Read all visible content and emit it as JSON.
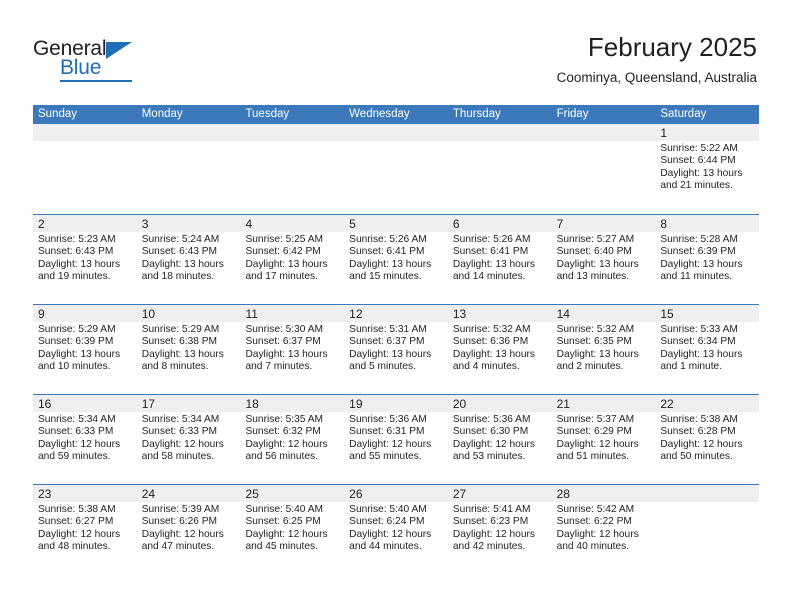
{
  "brand": {
    "name_part1": "General",
    "name_part2": "Blue",
    "accent_color": "#1f6fb5"
  },
  "header": {
    "month_title": "February 2025",
    "location": "Coominya, Queensland, Australia"
  },
  "calendar": {
    "header_bg": "#3b79ba",
    "daynum_band_bg": "#efefef",
    "day_headers": [
      "Sunday",
      "Monday",
      "Tuesday",
      "Wednesday",
      "Thursday",
      "Friday",
      "Saturday"
    ],
    "weeks": [
      [
        {
          "day": "",
          "empty": true
        },
        {
          "day": "",
          "empty": true
        },
        {
          "day": "",
          "empty": true
        },
        {
          "day": "",
          "empty": true
        },
        {
          "day": "",
          "empty": true
        },
        {
          "day": "",
          "empty": true
        },
        {
          "day": "1",
          "sunrise": "Sunrise: 5:22 AM",
          "sunset": "Sunset: 6:44 PM",
          "daylight": "Daylight: 13 hours and 21 minutes."
        }
      ],
      [
        {
          "day": "2",
          "sunrise": "Sunrise: 5:23 AM",
          "sunset": "Sunset: 6:43 PM",
          "daylight": "Daylight: 13 hours and 19 minutes."
        },
        {
          "day": "3",
          "sunrise": "Sunrise: 5:24 AM",
          "sunset": "Sunset: 6:43 PM",
          "daylight": "Daylight: 13 hours and 18 minutes."
        },
        {
          "day": "4",
          "sunrise": "Sunrise: 5:25 AM",
          "sunset": "Sunset: 6:42 PM",
          "daylight": "Daylight: 13 hours and 17 minutes."
        },
        {
          "day": "5",
          "sunrise": "Sunrise: 5:26 AM",
          "sunset": "Sunset: 6:41 PM",
          "daylight": "Daylight: 13 hours and 15 minutes."
        },
        {
          "day": "6",
          "sunrise": "Sunrise: 5:26 AM",
          "sunset": "Sunset: 6:41 PM",
          "daylight": "Daylight: 13 hours and 14 minutes."
        },
        {
          "day": "7",
          "sunrise": "Sunrise: 5:27 AM",
          "sunset": "Sunset: 6:40 PM",
          "daylight": "Daylight: 13 hours and 13 minutes."
        },
        {
          "day": "8",
          "sunrise": "Sunrise: 5:28 AM",
          "sunset": "Sunset: 6:39 PM",
          "daylight": "Daylight: 13 hours and 11 minutes."
        }
      ],
      [
        {
          "day": "9",
          "sunrise": "Sunrise: 5:29 AM",
          "sunset": "Sunset: 6:39 PM",
          "daylight": "Daylight: 13 hours and 10 minutes."
        },
        {
          "day": "10",
          "sunrise": "Sunrise: 5:29 AM",
          "sunset": "Sunset: 6:38 PM",
          "daylight": "Daylight: 13 hours and 8 minutes."
        },
        {
          "day": "11",
          "sunrise": "Sunrise: 5:30 AM",
          "sunset": "Sunset: 6:37 PM",
          "daylight": "Daylight: 13 hours and 7 minutes."
        },
        {
          "day": "12",
          "sunrise": "Sunrise: 5:31 AM",
          "sunset": "Sunset: 6:37 PM",
          "daylight": "Daylight: 13 hours and 5 minutes."
        },
        {
          "day": "13",
          "sunrise": "Sunrise: 5:32 AM",
          "sunset": "Sunset: 6:36 PM",
          "daylight": "Daylight: 13 hours and 4 minutes."
        },
        {
          "day": "14",
          "sunrise": "Sunrise: 5:32 AM",
          "sunset": "Sunset: 6:35 PM",
          "daylight": "Daylight: 13 hours and 2 minutes."
        },
        {
          "day": "15",
          "sunrise": "Sunrise: 5:33 AM",
          "sunset": "Sunset: 6:34 PM",
          "daylight": "Daylight: 13 hours and 1 minute."
        }
      ],
      [
        {
          "day": "16",
          "sunrise": "Sunrise: 5:34 AM",
          "sunset": "Sunset: 6:33 PM",
          "daylight": "Daylight: 12 hours and 59 minutes."
        },
        {
          "day": "17",
          "sunrise": "Sunrise: 5:34 AM",
          "sunset": "Sunset: 6:33 PM",
          "daylight": "Daylight: 12 hours and 58 minutes."
        },
        {
          "day": "18",
          "sunrise": "Sunrise: 5:35 AM",
          "sunset": "Sunset: 6:32 PM",
          "daylight": "Daylight: 12 hours and 56 minutes."
        },
        {
          "day": "19",
          "sunrise": "Sunrise: 5:36 AM",
          "sunset": "Sunset: 6:31 PM",
          "daylight": "Daylight: 12 hours and 55 minutes."
        },
        {
          "day": "20",
          "sunrise": "Sunrise: 5:36 AM",
          "sunset": "Sunset: 6:30 PM",
          "daylight": "Daylight: 12 hours and 53 minutes."
        },
        {
          "day": "21",
          "sunrise": "Sunrise: 5:37 AM",
          "sunset": "Sunset: 6:29 PM",
          "daylight": "Daylight: 12 hours and 51 minutes."
        },
        {
          "day": "22",
          "sunrise": "Sunrise: 5:38 AM",
          "sunset": "Sunset: 6:28 PM",
          "daylight": "Daylight: 12 hours and 50 minutes."
        }
      ],
      [
        {
          "day": "23",
          "sunrise": "Sunrise: 5:38 AM",
          "sunset": "Sunset: 6:27 PM",
          "daylight": "Daylight: 12 hours and 48 minutes."
        },
        {
          "day": "24",
          "sunrise": "Sunrise: 5:39 AM",
          "sunset": "Sunset: 6:26 PM",
          "daylight": "Daylight: 12 hours and 47 minutes."
        },
        {
          "day": "25",
          "sunrise": "Sunrise: 5:40 AM",
          "sunset": "Sunset: 6:25 PM",
          "daylight": "Daylight: 12 hours and 45 minutes."
        },
        {
          "day": "26",
          "sunrise": "Sunrise: 5:40 AM",
          "sunset": "Sunset: 6:24 PM",
          "daylight": "Daylight: 12 hours and 44 minutes."
        },
        {
          "day": "27",
          "sunrise": "Sunrise: 5:41 AM",
          "sunset": "Sunset: 6:23 PM",
          "daylight": "Daylight: 12 hours and 42 minutes."
        },
        {
          "day": "28",
          "sunrise": "Sunrise: 5:42 AM",
          "sunset": "Sunset: 6:22 PM",
          "daylight": "Daylight: 12 hours and 40 minutes."
        },
        {
          "day": "",
          "empty": true
        }
      ]
    ]
  }
}
